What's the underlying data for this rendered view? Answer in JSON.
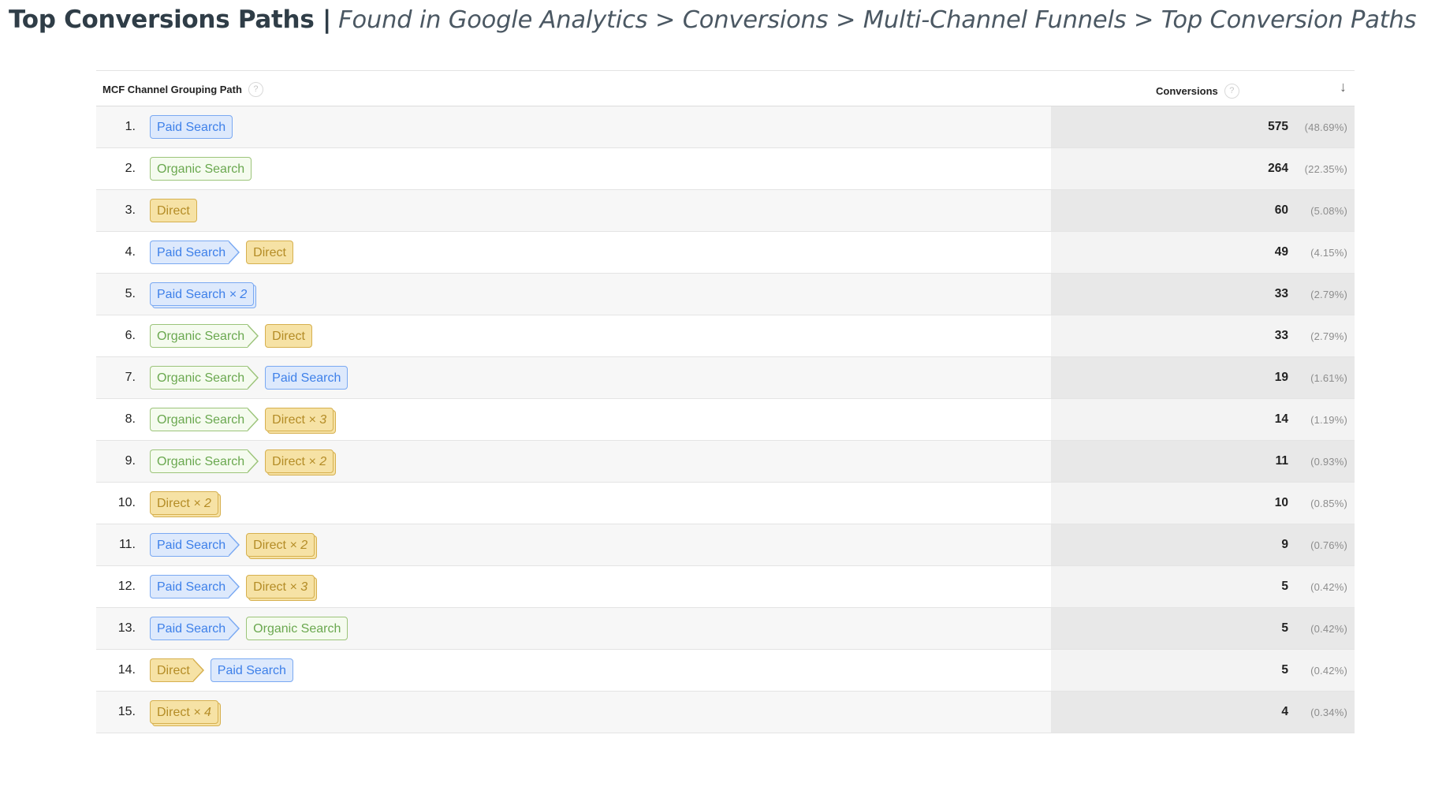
{
  "title": {
    "bold": "Top Conversions Paths |",
    "italic": "Found in Google Analytics > Conversions > Multi-Channel Funnels > Top Conversion Paths"
  },
  "table": {
    "columns": {
      "path": "MCF Channel Grouping Path",
      "conversions": "Conversions",
      "help_glyph": "?",
      "sort_glyph": "↓"
    },
    "channel_colors": {
      "paid": {
        "bg": "#dde9fc",
        "border": "#7aa9f2",
        "text": "#3e80e9"
      },
      "organic": {
        "bg": "#f5fbef",
        "border": "#9cc47a",
        "text": "#6aa84f"
      },
      "direct": {
        "bg": "#f6e2a5",
        "border": "#d6b04f",
        "text": "#b48c26"
      }
    },
    "rows": [
      {
        "rank": "1.",
        "path": [
          {
            "channel": "paid",
            "label": "Paid Search",
            "mult": ""
          }
        ],
        "conversions": "575",
        "percent": "(48.69%)"
      },
      {
        "rank": "2.",
        "path": [
          {
            "channel": "organic",
            "label": "Organic Search",
            "mult": ""
          }
        ],
        "conversions": "264",
        "percent": "(22.35%)"
      },
      {
        "rank": "3.",
        "path": [
          {
            "channel": "direct",
            "label": "Direct",
            "mult": ""
          }
        ],
        "conversions": "60",
        "percent": "(5.08%)"
      },
      {
        "rank": "4.",
        "path": [
          {
            "channel": "paid",
            "label": "Paid Search",
            "mult": ""
          },
          {
            "channel": "direct",
            "label": "Direct",
            "mult": ""
          }
        ],
        "conversions": "49",
        "percent": "(4.15%)"
      },
      {
        "rank": "5.",
        "path": [
          {
            "channel": "paid",
            "label": "Paid Search",
            "mult": "× 2"
          }
        ],
        "conversions": "33",
        "percent": "(2.79%)"
      },
      {
        "rank": "6.",
        "path": [
          {
            "channel": "organic",
            "label": "Organic Search",
            "mult": ""
          },
          {
            "channel": "direct",
            "label": "Direct",
            "mult": ""
          }
        ],
        "conversions": "33",
        "percent": "(2.79%)"
      },
      {
        "rank": "7.",
        "path": [
          {
            "channel": "organic",
            "label": "Organic Search",
            "mult": ""
          },
          {
            "channel": "paid",
            "label": "Paid Search",
            "mult": ""
          }
        ],
        "conversions": "19",
        "percent": "(1.61%)"
      },
      {
        "rank": "8.",
        "path": [
          {
            "channel": "organic",
            "label": "Organic Search",
            "mult": ""
          },
          {
            "channel": "direct",
            "label": "Direct",
            "mult": "× 3"
          }
        ],
        "conversions": "14",
        "percent": "(1.19%)"
      },
      {
        "rank": "9.",
        "path": [
          {
            "channel": "organic",
            "label": "Organic Search",
            "mult": ""
          },
          {
            "channel": "direct",
            "label": "Direct",
            "mult": "× 2"
          }
        ],
        "conversions": "11",
        "percent": "(0.93%)"
      },
      {
        "rank": "10.",
        "path": [
          {
            "channel": "direct",
            "label": "Direct",
            "mult": "× 2"
          }
        ],
        "conversions": "10",
        "percent": "(0.85%)"
      },
      {
        "rank": "11.",
        "path": [
          {
            "channel": "paid",
            "label": "Paid Search",
            "mult": ""
          },
          {
            "channel": "direct",
            "label": "Direct",
            "mult": "× 2"
          }
        ],
        "conversions": "9",
        "percent": "(0.76%)"
      },
      {
        "rank": "12.",
        "path": [
          {
            "channel": "paid",
            "label": "Paid Search",
            "mult": ""
          },
          {
            "channel": "direct",
            "label": "Direct",
            "mult": "× 3"
          }
        ],
        "conversions": "5",
        "percent": "(0.42%)"
      },
      {
        "rank": "13.",
        "path": [
          {
            "channel": "paid",
            "label": "Paid Search",
            "mult": ""
          },
          {
            "channel": "organic",
            "label": "Organic Search",
            "mult": ""
          }
        ],
        "conversions": "5",
        "percent": "(0.42%)"
      },
      {
        "rank": "14.",
        "path": [
          {
            "channel": "direct",
            "label": "Direct",
            "mult": ""
          },
          {
            "channel": "paid",
            "label": "Paid Search",
            "mult": ""
          }
        ],
        "conversions": "5",
        "percent": "(0.42%)"
      },
      {
        "rank": "15.",
        "path": [
          {
            "channel": "direct",
            "label": "Direct",
            "mult": "× 4"
          }
        ],
        "conversions": "4",
        "percent": "(0.34%)"
      }
    ]
  }
}
